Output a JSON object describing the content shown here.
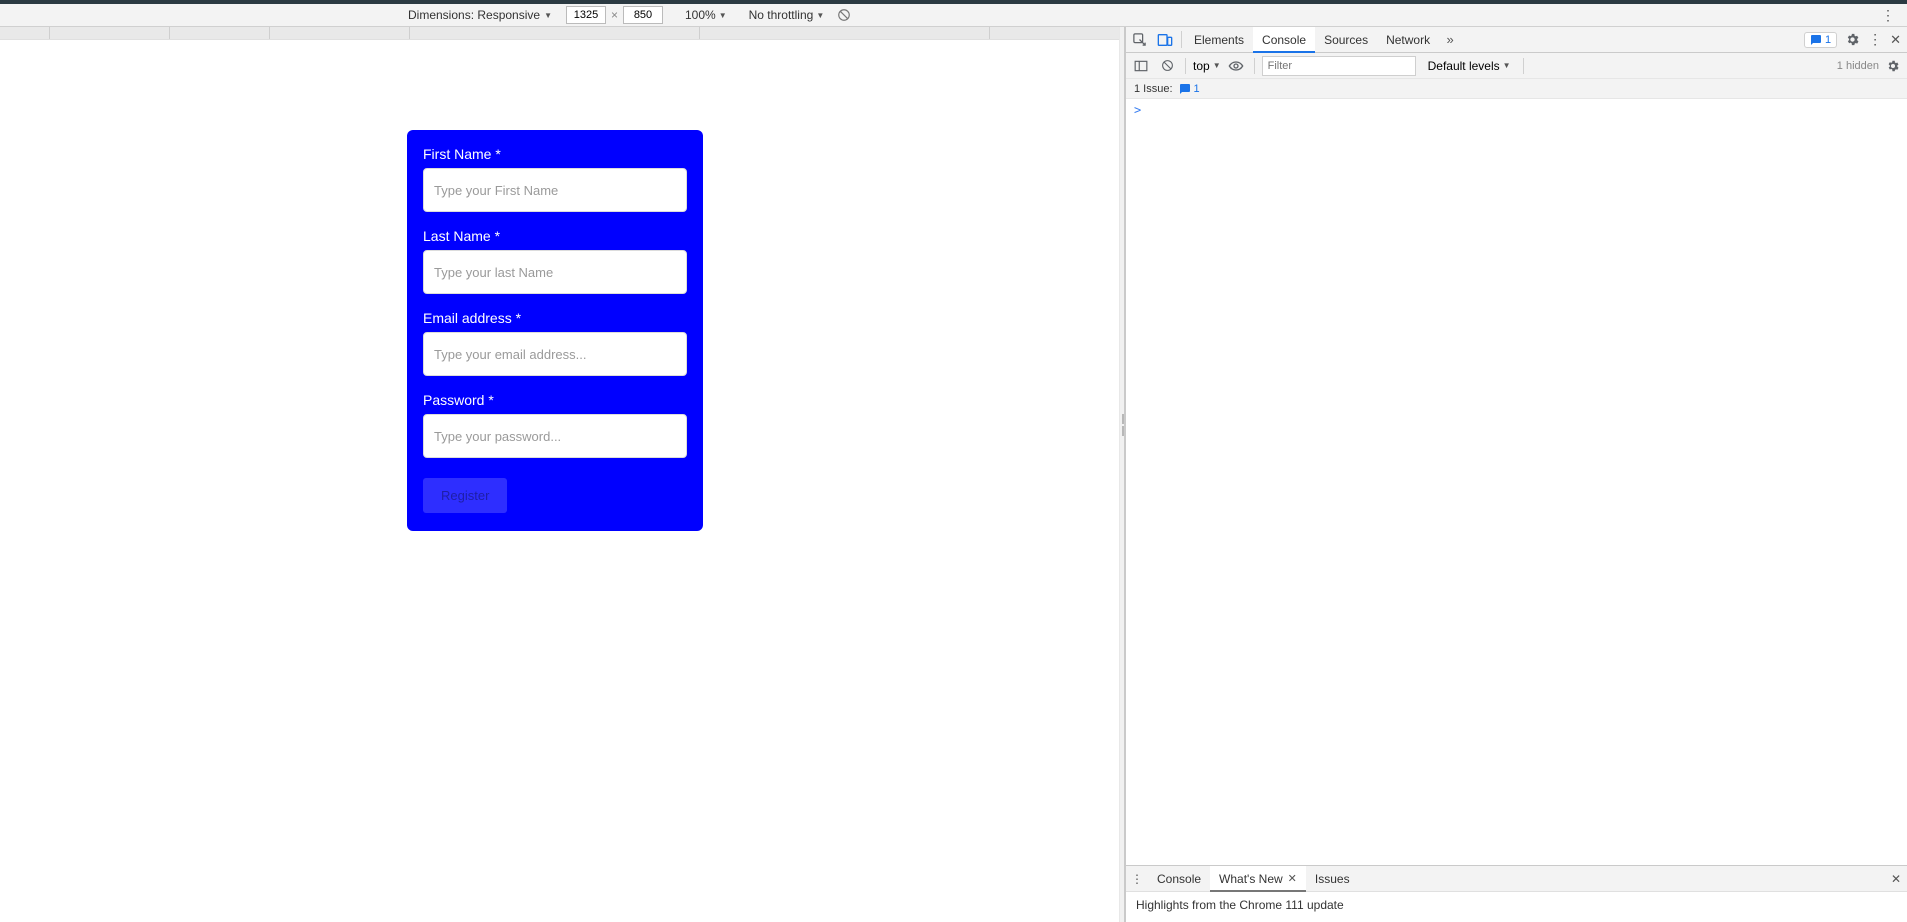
{
  "deviceToolbar": {
    "dimensionsLabel": "Dimensions: Responsive",
    "width": "1325",
    "height": "850",
    "zoom": "100%",
    "throttling": "No throttling"
  },
  "devtools": {
    "tabs": {
      "elements": "Elements",
      "console": "Console",
      "sources": "Sources",
      "network": "Network"
    },
    "issuesCount": "1",
    "consoleToolbar": {
      "context": "top",
      "filterPlaceholder": "Filter",
      "levels": "Default levels",
      "hidden": "1 hidden"
    },
    "issuesBar": {
      "label": "1 Issue:",
      "count": "1"
    },
    "prompt": ">",
    "drawer": {
      "tabs": {
        "console": "Console",
        "whatsNew": "What's New",
        "issues": "Issues"
      },
      "body": "Highlights from the Chrome 111 update"
    }
  },
  "form": {
    "firstName": {
      "label": "First Name *",
      "placeholder": "Type your First Name"
    },
    "lastName": {
      "label": "Last Name *",
      "placeholder": "Type your last Name"
    },
    "email": {
      "label": "Email address *",
      "placeholder": "Type your email address..."
    },
    "password": {
      "label": "Password *",
      "placeholder": "Type your password..."
    },
    "submit": "Register"
  }
}
